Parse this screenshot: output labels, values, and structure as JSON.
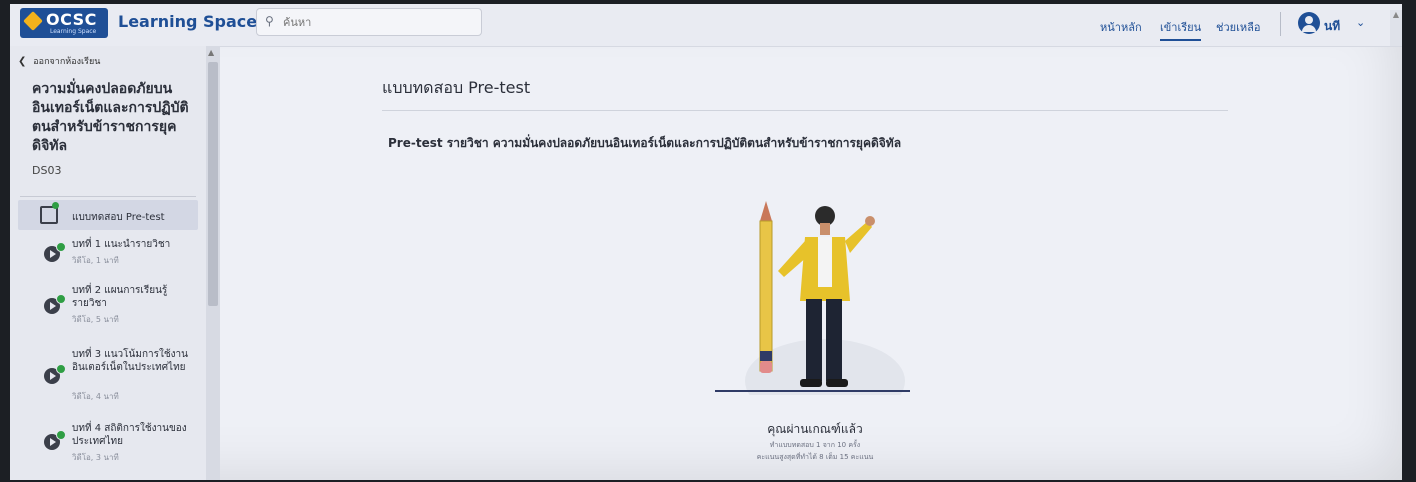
{
  "header": {
    "logo_text": "OCSC",
    "logo_sub": "Learning Space",
    "app_title": "Learning Space",
    "search_placeholder": "ค้นหา",
    "nav": [
      "หน้าหลัก",
      "เข้าเรียน",
      "ช่วยเหลือ"
    ],
    "username": "นที",
    "brand_color": "#1f4f96"
  },
  "sidebar": {
    "back_label": "ออกจากห้องเรียน",
    "course_title": "ความมั่นคงปลอดภัยบนอินเทอร์เน็ตและการปฏิบัติตนสำหรับข้าราชการยุคดิจิทัล",
    "course_code": "DS03",
    "active_item": "แบบทดสอบ Pre-test",
    "lessons": [
      {
        "title": "บทที่ 1 แนะนำรายวิชา",
        "meta": "วิดีโอ, 1 นาที"
      },
      {
        "title": "บทที่ 2 แผนการเรียนรู้รายวิชา",
        "meta": "วิดีโอ, 5 นาที"
      },
      {
        "title": "บทที่ 3 แนวโน้มการใช้งานอินเตอร์เน็ตในประเทศไทย",
        "meta": "วิดีโอ, 4 นาที"
      },
      {
        "title": "บทที่ 4 สถิติการใช้งานของประเทศไทย",
        "meta": "วิดีโอ, 3 นาที"
      }
    ],
    "complete_color": "#2f9e44"
  },
  "main": {
    "page_title": "แบบทดสอบ Pre-test",
    "heading": "Pre-test รายวิชา ความมั่นคงปลอดภัยบนอินเทอร์เน็ตและการปฏิบัติตนสำหรับข้าราชการยุคดิจิทัล",
    "pass_text": "คุณผ่านเกณฑ์แล้ว",
    "attempts_text": "ทำแบบทดสอบ 1 จาก 10 ครั้ง",
    "score_text": "คะแนนสูงสุดที่ทำได้ 8 เต็ม 15 คะแนน"
  }
}
